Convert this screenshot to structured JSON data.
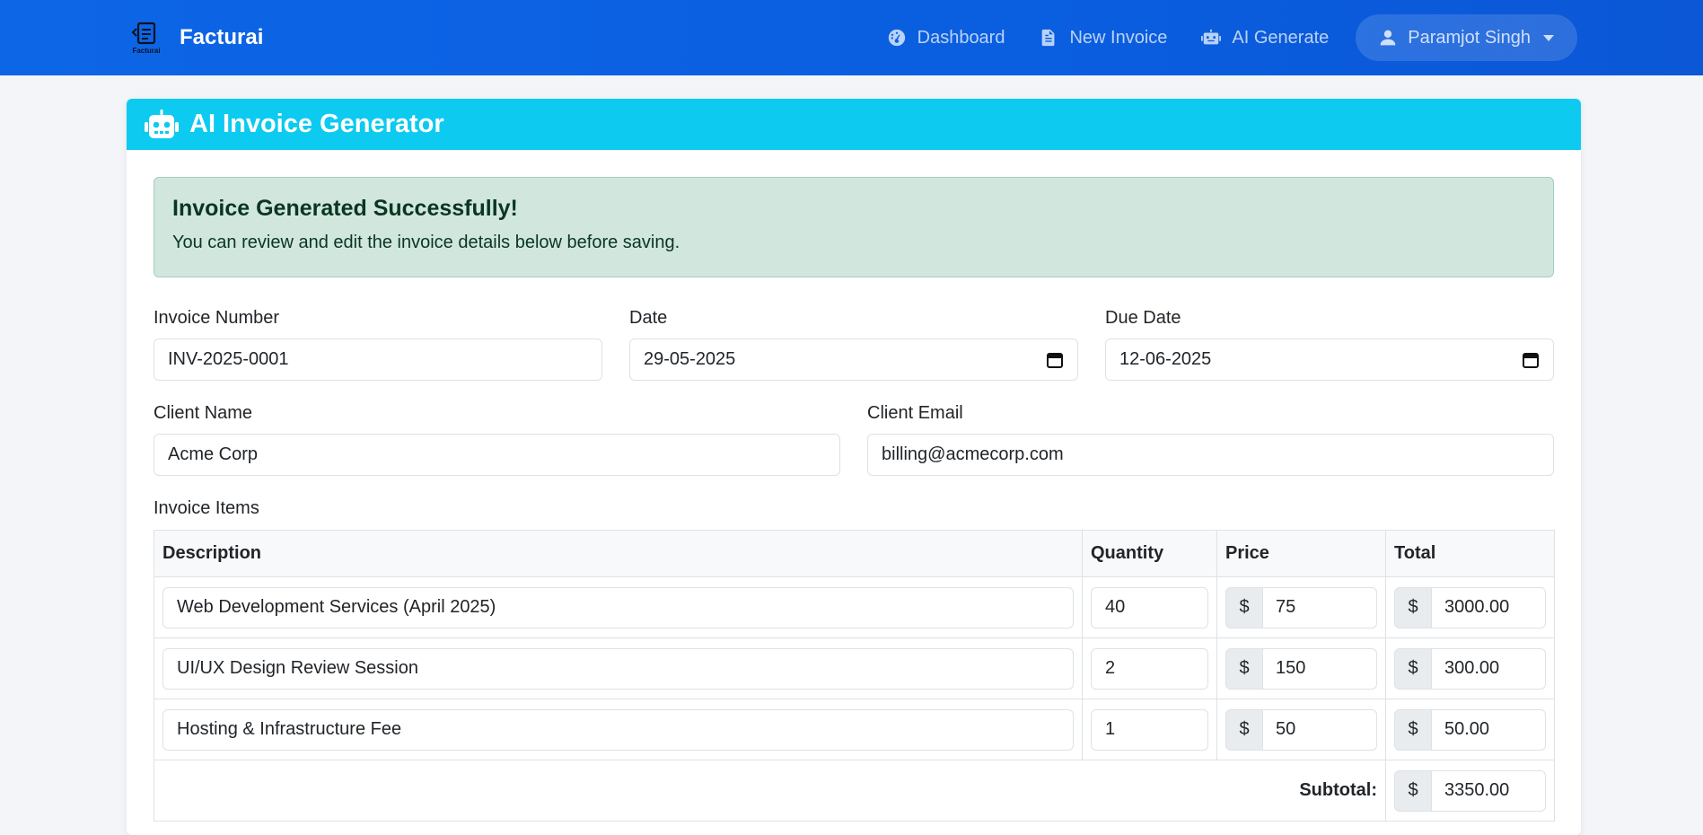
{
  "navbar": {
    "brand_name": "Facturai",
    "logo_text": "Facturai",
    "links": [
      {
        "label": "Dashboard",
        "icon": "dashboard-icon"
      },
      {
        "label": "New Invoice",
        "icon": "file-icon"
      },
      {
        "label": "AI Generate",
        "icon": "robot-icon"
      }
    ],
    "user": {
      "name": "Paramjot Singh",
      "icon": "user-icon"
    }
  },
  "card": {
    "title": "AI Invoice Generator",
    "header_color": "#0dcaf0"
  },
  "alert": {
    "heading": "Invoice Generated Successfully!",
    "text": "You can review and edit the invoice details below before saving."
  },
  "form": {
    "invoice_number": {
      "label": "Invoice Number",
      "value": "INV-2025-0001"
    },
    "date": {
      "label": "Date",
      "value": "29-05-2025"
    },
    "due_date": {
      "label": "Due Date",
      "value": "12-06-2025"
    },
    "client_name": {
      "label": "Client Name",
      "value": "Acme Corp"
    },
    "client_email": {
      "label": "Client Email",
      "value": "billing@acmecorp.com"
    }
  },
  "items": {
    "label": "Invoice Items",
    "columns": [
      "Description",
      "Quantity",
      "Price",
      "Total"
    ],
    "currency": "$",
    "rows": [
      {
        "description": "Web Development Services (April 2025)",
        "quantity": "40",
        "price": "75",
        "total": "3000.00"
      },
      {
        "description": "UI/UX Design Review Session",
        "quantity": "2",
        "price": "150",
        "total": "300.00"
      },
      {
        "description": "Hosting & Infrastructure Fee",
        "quantity": "1",
        "price": "50",
        "total": "50.00"
      }
    ],
    "subtotal_label": "Subtotal:",
    "subtotal_value": "3350.00"
  },
  "colors": {
    "navbar": "#0d66e6",
    "alert_bg": "#d1e7dd"
  }
}
